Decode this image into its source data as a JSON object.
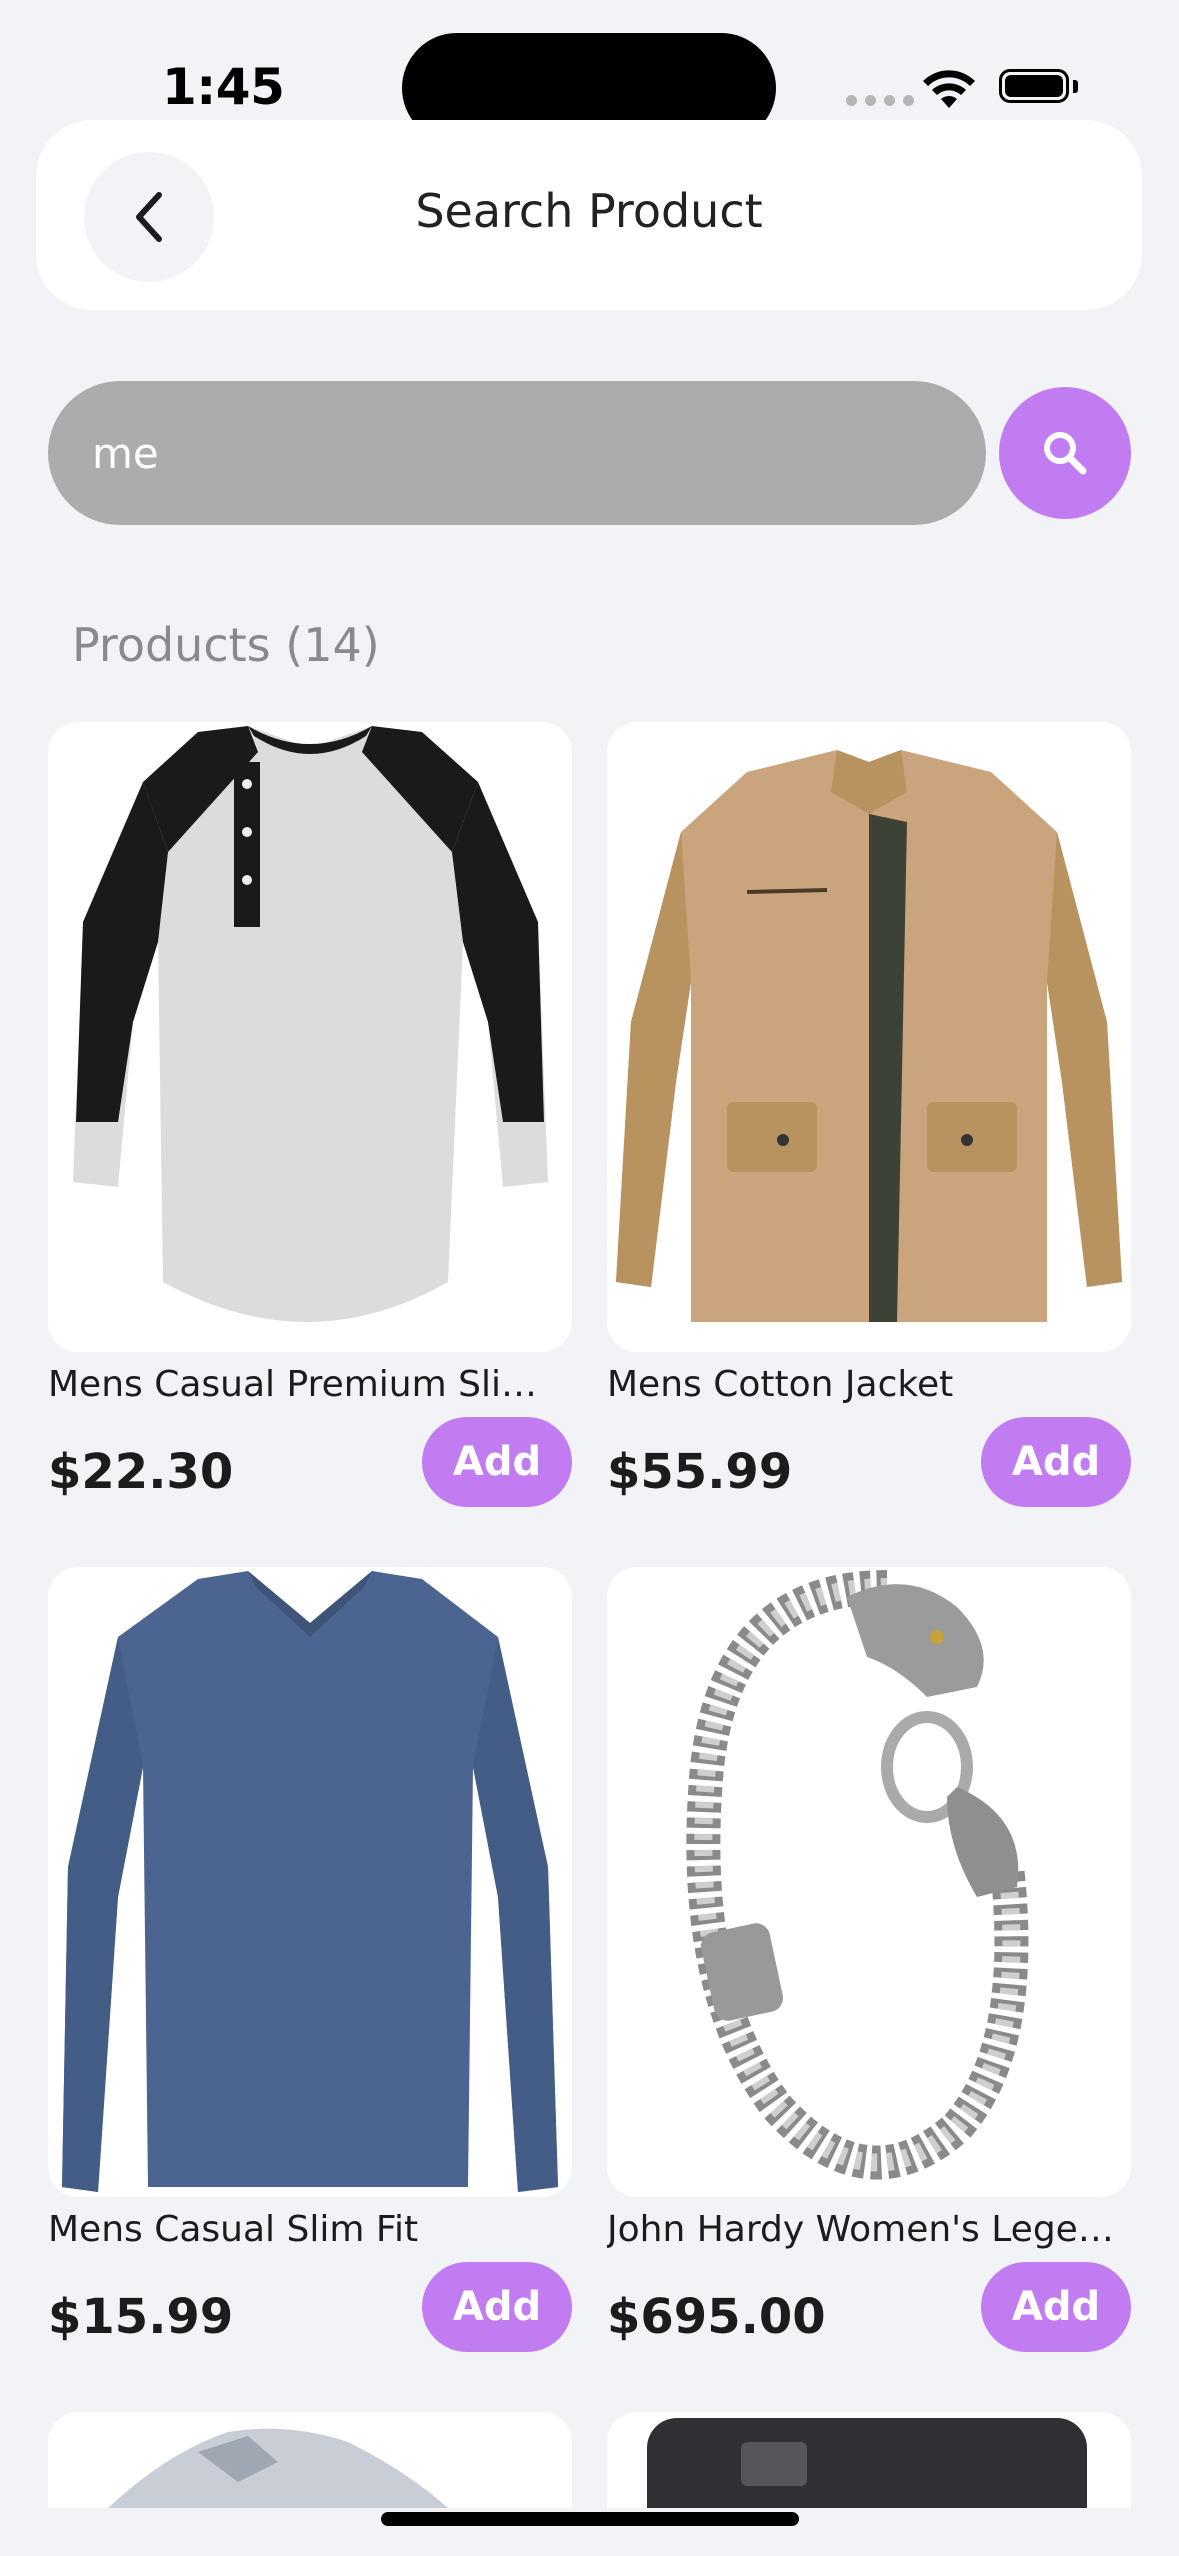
{
  "status_bar": {
    "time": "1:45"
  },
  "header": {
    "title": "Search Product"
  },
  "search": {
    "value": "me",
    "placeholder": ""
  },
  "products_section": {
    "title": "Products (14)"
  },
  "products": [
    {
      "name": "Mens Casual Premium Slim ...",
      "price": "$22.30",
      "add_label": "Add",
      "image": "henley-shirt"
    },
    {
      "name": "Mens Cotton Jacket",
      "price": "$55.99",
      "add_label": "Add",
      "image": "cotton-jacket"
    },
    {
      "name": "Mens Casual Slim Fit",
      "price": "$15.99",
      "add_label": "Add",
      "image": "long-sleeve-tshirt"
    },
    {
      "name": "John Hardy Women's Legen...",
      "price": "$695.00",
      "add_label": "Add",
      "image": "dragon-bracelet"
    }
  ],
  "colors": {
    "accent": "#c27cf2",
    "background": "#f2f3f7",
    "search_field": "#acacac"
  }
}
